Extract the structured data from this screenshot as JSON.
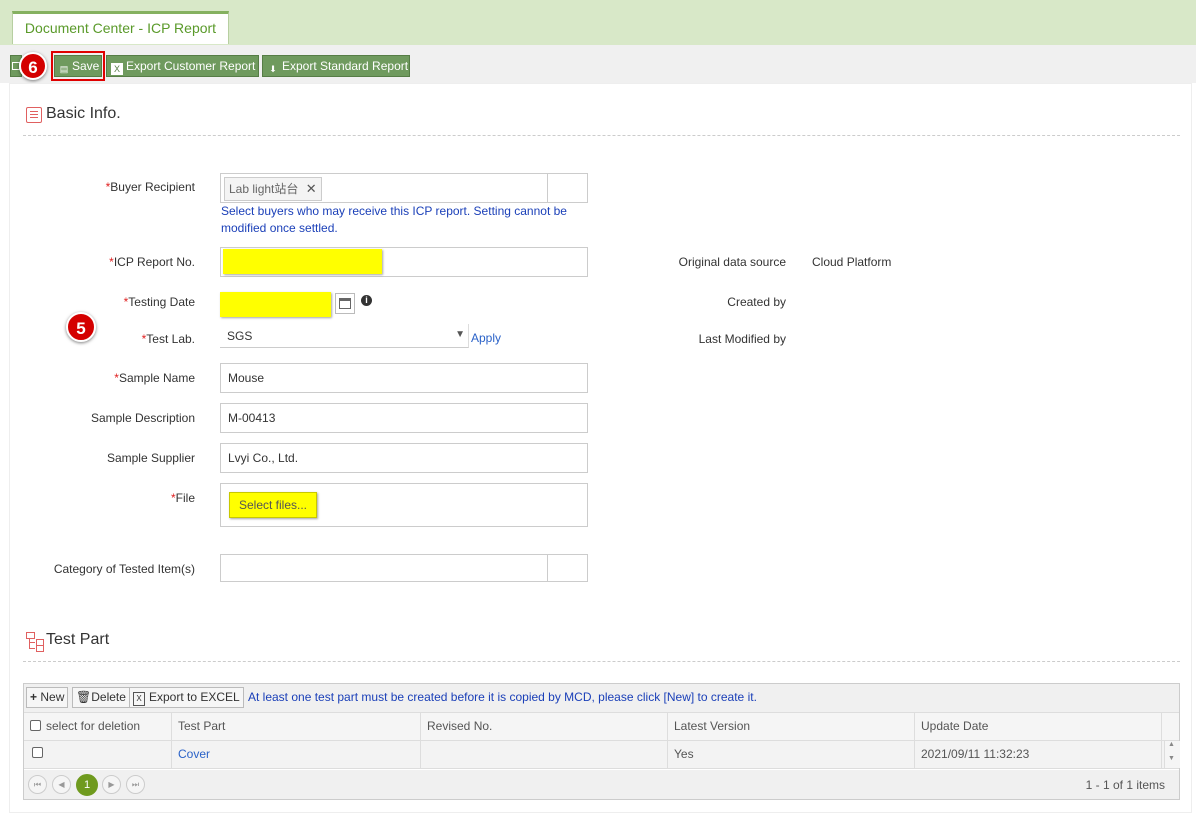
{
  "tab": {
    "title": "Document Center - ICP Report"
  },
  "toolbar": {
    "save_label": "Save",
    "export_customer_label": "Export Customer Report",
    "export_standard_label": "Export Standard Report"
  },
  "badges": {
    "save_step": "6",
    "form_step": "5"
  },
  "basic_info": {
    "title": "Basic Info.",
    "buyer_recipient": {
      "label": "Buyer Recipient",
      "tag": "Lab light站台",
      "hint_line1": "Select buyers who may receive this ICP report. Setting cannot be",
      "hint_line2": "modified once settled."
    },
    "icp_report_no": {
      "label": "ICP Report No.",
      "value": ""
    },
    "testing_date": {
      "label": "Testing Date",
      "value": ""
    },
    "test_lab": {
      "label": "Test Lab.",
      "value": "SGS",
      "apply_label": "Apply"
    },
    "sample_name": {
      "label": "Sample Name",
      "value": "Mouse"
    },
    "sample_description": {
      "label": "Sample Description",
      "value": "M-00413"
    },
    "sample_supplier": {
      "label": "Sample Supplier",
      "value": "Lvyi Co., Ltd."
    },
    "file": {
      "label": "File",
      "button_label": "Select files..."
    },
    "category": {
      "label": "Category of Tested Item(s)",
      "value": ""
    },
    "original_data_source": {
      "label": "Original data source",
      "value": "Cloud Platform"
    },
    "created_by": {
      "label": "Created by",
      "value": ""
    },
    "last_modified_by": {
      "label": "Last Modified by",
      "value": ""
    }
  },
  "test_part": {
    "title": "Test Part",
    "new_label": "New",
    "delete_label": "Delete",
    "export_excel_label": "Export to EXCEL",
    "notice": "At least one test part must be created before it is copied by MCD, please click [New] to create it.",
    "columns": [
      "select for deletion",
      "Test Part",
      "Revised No.",
      "Latest Version",
      "Update Date"
    ],
    "rows": [
      {
        "test_part": "Cover",
        "revised_no": "",
        "latest_version": "Yes",
        "update_date": "2021/09/11 11:32:23"
      }
    ],
    "pager": {
      "current_page": "1",
      "summary": "1 - 1 of 1 items"
    }
  },
  "colors": {
    "accent_green": "#6f9a5e",
    "highlight": "#ffff00",
    "badge_red": "#d40000",
    "link_blue": "#1a3fb8"
  }
}
